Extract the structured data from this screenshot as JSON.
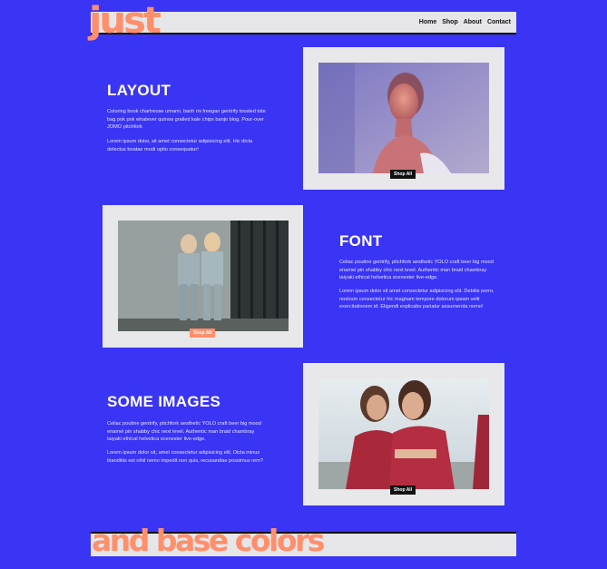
{
  "header": {
    "logo": "just",
    "nav": [
      "Home",
      "Shop",
      "About",
      "Contact"
    ]
  },
  "sections": [
    {
      "title": "LAYOUT",
      "paragraphs": [
        "Coloring book chartreuse umami, banh mi freegan gentrify tousled tote bag pok pok whatever quinoa grailed kale chips banjo blog. Pour-over JOMO pitchfork",
        "Lorem ipsum dolor, sit amet consectetur adipisicing elit. Hic dicta delectus beatae modi optio consequatur!"
      ],
      "button": "Shop All"
    },
    {
      "title": "FONT",
      "paragraphs": [
        "Celiac poutine gentrify, pitchfork aesthetic YOLO craft beer big mood enamel pin shabby chic next level. Authentic man braid chambray taiyaki ethical helvetica scenester live-edge.",
        "Lorem ipsum dolor sit amet consectetur adipisicing elit. Debitis porro, nostrum consectetur hic magnam tempore dolorum ipsam velit exercitationem id. Eligendi explicabo pariatur assumenda nemo!"
      ],
      "button": "Shop All"
    },
    {
      "title": "SOME IMAGES",
      "paragraphs": [
        "Celiac poutine gentrify, pitchfork aesthetic YOLO craft beer big mood enamel pin shabby chic next level. Authentic man braid chambray taiyaki ethical helvetica scenester live-edge.",
        "Lorem ipsum dolor sit, amet consectetur adipisicing elit. Dicta minus blanditiis est nihil nemo impedit non quis, recusandae possimus rem?"
      ],
      "button": "Shop All"
    }
  ],
  "footer": {
    "text": "and base colors"
  },
  "colors": {
    "background": "#3a34f4",
    "accent": "#ff8f6b",
    "card": "#e8e8ea"
  }
}
